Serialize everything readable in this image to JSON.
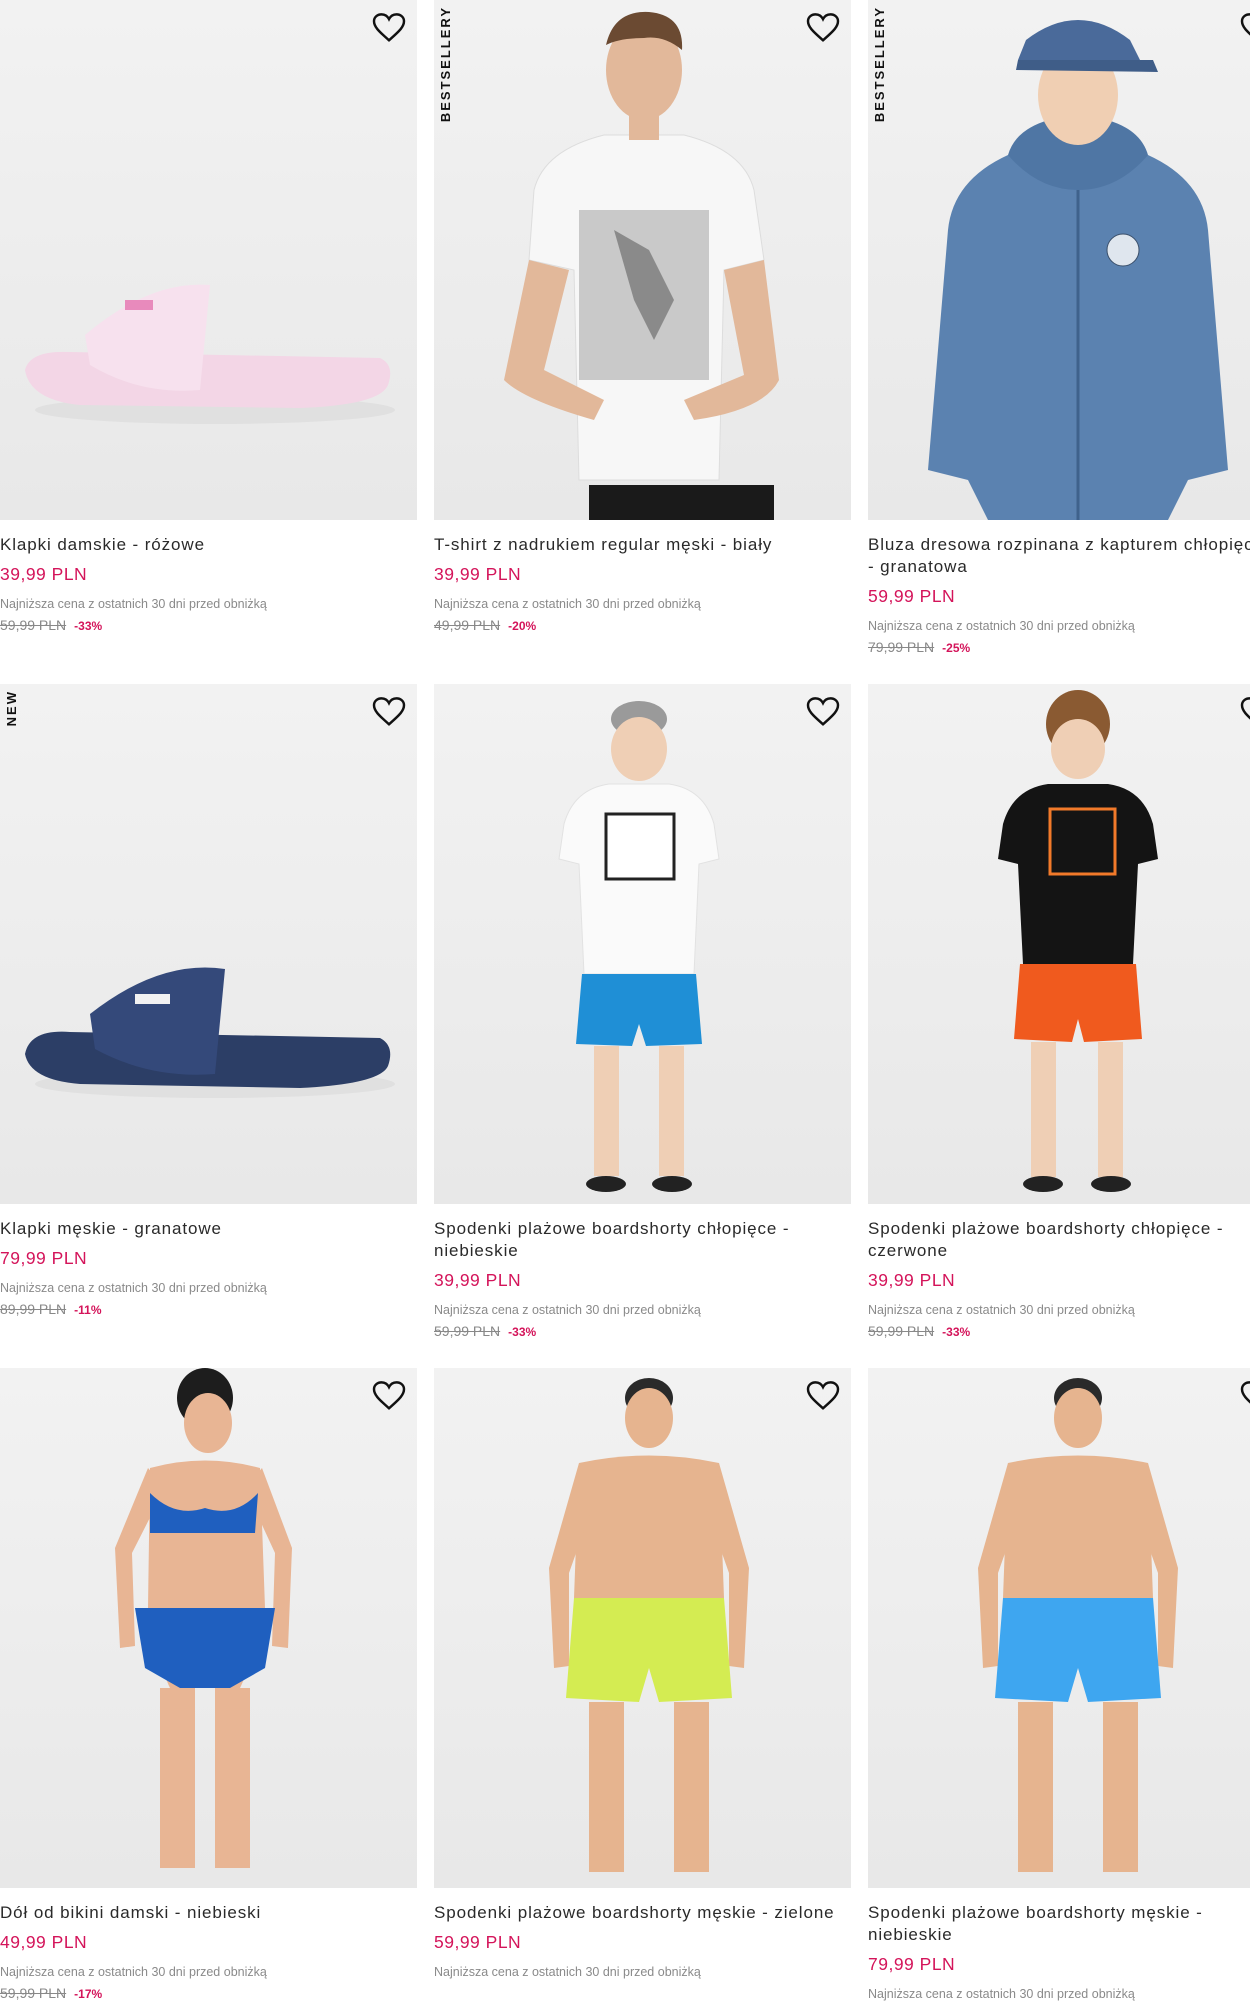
{
  "products": [
    {
      "title": "Klapki damskie - różowe",
      "price": "39,99 PLN",
      "lowest_label": "Najniższa cena z ostatnich 30 dni przed obniżką",
      "old_price": "59,99 PLN",
      "discount": "-33%",
      "badge": ""
    },
    {
      "title": "T-shirt z nadrukiem regular męski - biały",
      "price": "39,99 PLN",
      "lowest_label": "Najniższa cena z ostatnich 30 dni przed obniżką",
      "old_price": "49,99 PLN",
      "discount": "-20%",
      "badge": "BESTSELLERY"
    },
    {
      "title": "Bluza dresowa rozpinana z kapturem chłopięca - granatowa",
      "price": "59,99 PLN",
      "lowest_label": "Najniższa cena z ostatnich 30 dni przed obniżką",
      "old_price": "79,99 PLN",
      "discount": "-25%",
      "badge": "BESTSELLERY"
    },
    {
      "title": "Klapki męskie - granatowe",
      "price": "79,99 PLN",
      "lowest_label": "Najniższa cena z ostatnich 30 dni przed obniżką",
      "old_price": "89,99 PLN",
      "discount": "-11%",
      "badge": "NEW"
    },
    {
      "title": "Spodenki plażowe boardshorty chłopięce - niebieskie",
      "price": "39,99 PLN",
      "lowest_label": "Najniższa cena z ostatnich 30 dni przed obniżką",
      "old_price": "59,99 PLN",
      "discount": "-33%",
      "badge": ""
    },
    {
      "title": "Spodenki plażowe boardshorty chłopięce - czerwone",
      "price": "39,99 PLN",
      "lowest_label": "Najniższa cena z ostatnich 30 dni przed obniżką",
      "old_price": "59,99 PLN",
      "discount": "-33%",
      "badge": ""
    },
    {
      "title": "Dół od bikini damski - niebieski",
      "price": "49,99 PLN",
      "lowest_label": "Najniższa cena z ostatnich 30 dni przed obniżką",
      "old_price": "59,99 PLN",
      "discount": "-17%",
      "badge": ""
    },
    {
      "title": "Spodenki plażowe boardshorty męskie - zielone",
      "price": "59,99 PLN",
      "lowest_label": "Najniższa cena z ostatnich 30 dni przed obniżką",
      "old_price": "",
      "discount": "",
      "badge": ""
    },
    {
      "title": "Spodenki plażowe boardshorty męskie - niebieskie",
      "price": "79,99 PLN",
      "lowest_label": "Najniższa cena z ostatnich 30 dni przed obniżką",
      "old_price": "",
      "discount": "",
      "badge": ""
    }
  ],
  "colors": {
    "price": "#d4145a",
    "image_bg": "#ececec"
  },
  "icons": {
    "wishlist": "heart-outline-icon"
  }
}
